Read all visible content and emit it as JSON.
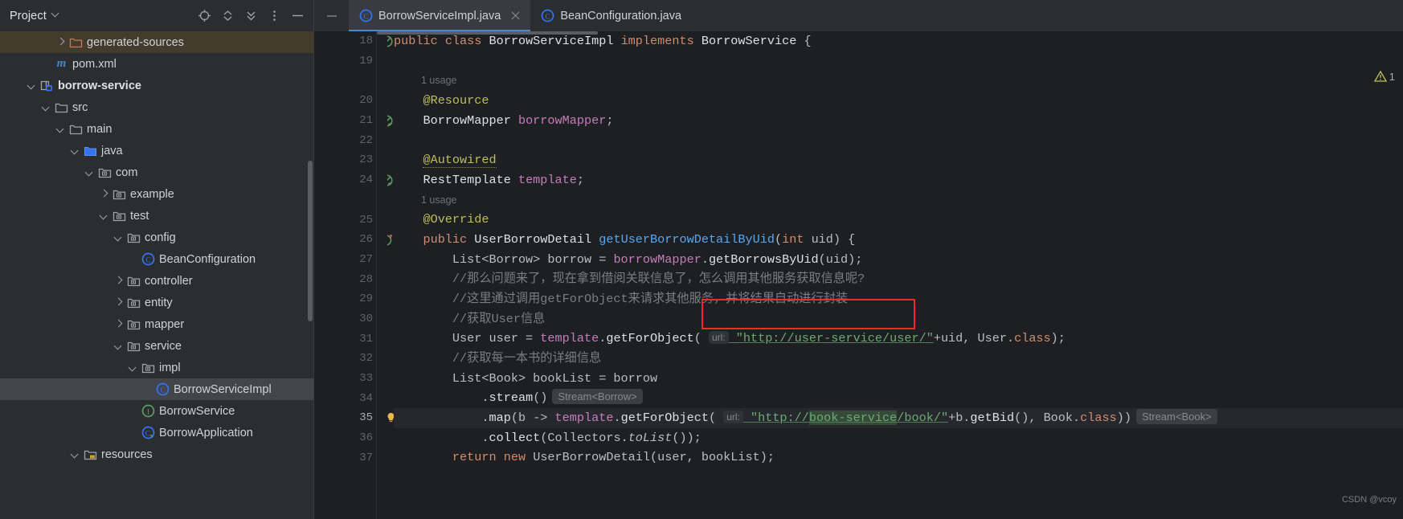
{
  "colors": {
    "panel_bg": "#2b2d30",
    "editor_bg": "#1e1f22",
    "accent_tab": "#4a88c7",
    "annotation_red": "#f42a28",
    "string_green": "#6aab73",
    "keyword_orange": "#cf8e6d",
    "field_purple": "#c77dbb",
    "method_blue": "#56a8f5",
    "comment_gray": "#7a7e85",
    "selected_row": "#43454a",
    "amber_row": "#433b2b"
  },
  "left_panel": {
    "title": "Project",
    "title_chevron_icon": "chevron-down-icon",
    "actions": [
      {
        "name": "locate-icon",
        "tooltip": "Select Opened File"
      },
      {
        "name": "expand-collapse-icon",
        "tooltip": "Expand All"
      },
      {
        "name": "collapse-all-icon",
        "tooltip": "Collapse All"
      },
      {
        "name": "more-options-icon",
        "tooltip": "Options"
      },
      {
        "name": "hide-panel-icon",
        "tooltip": "Hide"
      }
    ],
    "tree": [
      {
        "label": "generated-sources",
        "indent": 3,
        "twisty": "right",
        "icon": "folder-orange-icon",
        "highlight": "amber",
        "bold": false
      },
      {
        "label": "pom.xml",
        "indent": 2,
        "twisty": "none",
        "icon": "maven-m-icon",
        "highlight": "none",
        "bold": false
      },
      {
        "label": "borrow-service",
        "indent": 1,
        "twisty": "down",
        "icon": "module-icon",
        "highlight": "none",
        "bold": true
      },
      {
        "label": "src",
        "indent": 2,
        "twisty": "down",
        "icon": "folder-icon",
        "highlight": "none",
        "bold": false
      },
      {
        "label": "main",
        "indent": 3,
        "twisty": "down",
        "icon": "folder-icon",
        "highlight": "none",
        "bold": false
      },
      {
        "label": "java",
        "indent": 4,
        "twisty": "down",
        "icon": "source-root-icon",
        "highlight": "none",
        "bold": false
      },
      {
        "label": "com",
        "indent": 5,
        "twisty": "down",
        "icon": "package-icon",
        "highlight": "none",
        "bold": false
      },
      {
        "label": "example",
        "indent": 6,
        "twisty": "right",
        "icon": "package-icon",
        "highlight": "none",
        "bold": false
      },
      {
        "label": "test",
        "indent": 6,
        "twisty": "down",
        "icon": "package-icon",
        "highlight": "none",
        "bold": false
      },
      {
        "label": "config",
        "indent": 7,
        "twisty": "down",
        "icon": "package-icon",
        "highlight": "none",
        "bold": false
      },
      {
        "label": "BeanConfiguration",
        "indent": 8,
        "twisty": "none",
        "icon": "java-class-icon",
        "highlight": "none",
        "bold": false
      },
      {
        "label": "controller",
        "indent": 7,
        "twisty": "right",
        "icon": "package-icon",
        "highlight": "none",
        "bold": false
      },
      {
        "label": "entity",
        "indent": 7,
        "twisty": "right",
        "icon": "package-icon",
        "highlight": "none",
        "bold": false
      },
      {
        "label": "mapper",
        "indent": 7,
        "twisty": "right",
        "icon": "package-icon",
        "highlight": "none",
        "bold": false
      },
      {
        "label": "service",
        "indent": 7,
        "twisty": "down",
        "icon": "package-icon",
        "highlight": "none",
        "bold": false
      },
      {
        "label": "impl",
        "indent": 8,
        "twisty": "down",
        "icon": "package-icon",
        "highlight": "none",
        "bold": false
      },
      {
        "label": "BorrowServiceImpl",
        "indent": 9,
        "twisty": "none",
        "icon": "java-class-icon",
        "highlight": "selected",
        "bold": false
      },
      {
        "label": "BorrowService",
        "indent": 8,
        "twisty": "none",
        "icon": "java-interface-icon",
        "highlight": "none",
        "bold": false
      },
      {
        "label": "BorrowApplication",
        "indent": 8,
        "twisty": "none",
        "icon": "spring-class-icon",
        "highlight": "none",
        "bold": false
      },
      {
        "label": "resources",
        "indent": 4,
        "twisty": "down",
        "icon": "resource-root-icon",
        "highlight": "none",
        "bold": false
      }
    ]
  },
  "tabs": [
    {
      "label": "BorrowServiceImpl.java",
      "icon": "java-class-icon",
      "active": true,
      "closable": true
    },
    {
      "label": "BeanConfiguration.java",
      "icon": "java-class-icon",
      "active": false,
      "closable": false
    }
  ],
  "inspection_widget": {
    "icon": "warning-triangle-icon",
    "count": "1"
  },
  "watermark": "CSDN @vcoy",
  "editor": {
    "current_line": "35",
    "lines": [
      {
        "num": "18",
        "marker": "implementing-method-icon",
        "indent": 0,
        "tokens": [
          {
            "t": "public ",
            "c": "kw"
          },
          {
            "t": "class ",
            "c": "kw"
          },
          {
            "t": "BorrowServiceImpl ",
            "c": "cls"
          },
          {
            "t": "implements ",
            "c": "kw"
          },
          {
            "t": "BorrowService ",
            "c": "cls"
          },
          {
            "t": "{",
            "c": "pl"
          }
        ]
      },
      {
        "num": "19",
        "marker": "",
        "indent": 0,
        "tokens": []
      },
      {
        "num": "",
        "hint": "1 usage"
      },
      {
        "num": "20",
        "marker": "",
        "indent": 1,
        "tokens": [
          {
            "t": "@Resource",
            "c": "ann"
          }
        ]
      },
      {
        "num": "21",
        "marker": "implemented-interface-icon",
        "indent": 1,
        "tokens": [
          {
            "t": "BorrowMapper ",
            "c": "cls"
          },
          {
            "t": "borrowMapper",
            "c": "fld"
          },
          {
            "t": ";",
            "c": "pl"
          }
        ]
      },
      {
        "num": "22",
        "marker": "",
        "indent": 0,
        "tokens": []
      },
      {
        "num": "23",
        "marker": "",
        "indent": 1,
        "tokens": [
          {
            "t": "@Autowired",
            "c": "annu"
          }
        ]
      },
      {
        "num": "24",
        "marker": "implemented-interface-icon",
        "indent": 1,
        "tokens": [
          {
            "t": "RestTemplate ",
            "c": "cls"
          },
          {
            "t": "template",
            "c": "fld"
          },
          {
            "t": ";",
            "c": "pl"
          }
        ]
      },
      {
        "num": "",
        "hint": "1 usage"
      },
      {
        "num": "25",
        "marker": "",
        "indent": 1,
        "tokens": [
          {
            "t": "@Override",
            "c": "ann"
          }
        ]
      },
      {
        "num": "26",
        "marker": "overriding-method-icon",
        "indent": 1,
        "tokens": [
          {
            "t": "public ",
            "c": "kw"
          },
          {
            "t": "UserBorrowDetail ",
            "c": "cls"
          },
          {
            "t": "getUserBorrowDetailByUid",
            "c": "mth"
          },
          {
            "t": "(",
            "c": "pl"
          },
          {
            "t": "int",
            "c": "kw"
          },
          {
            "t": " uid) {",
            "c": "pl"
          }
        ]
      },
      {
        "num": "27",
        "marker": "",
        "indent": 2,
        "tokens": [
          {
            "t": "List<Borrow> borrow = ",
            "c": "pl"
          },
          {
            "t": "borrowMapper",
            "c": "fld"
          },
          {
            "t": ".",
            "c": "pl"
          },
          {
            "t": "getBorrowsByUid",
            "c": "mthy"
          },
          {
            "t": "(uid);",
            "c": "pl"
          }
        ]
      },
      {
        "num": "28",
        "marker": "",
        "indent": 2,
        "tokens": [
          {
            "t": "//那么问题来了，现在拿到借阅关联信息了，怎么调用其他服务获取信息呢?",
            "c": "cmt"
          }
        ]
      },
      {
        "num": "29",
        "marker": "",
        "indent": 2,
        "tokens": [
          {
            "t": "//这里通过调用getForObject来请求其他服务，并将结果自动进行封装",
            "c": "cmt"
          }
        ]
      },
      {
        "num": "30",
        "marker": "",
        "indent": 2,
        "tokens": [
          {
            "t": "//获取User信息",
            "c": "cmt"
          }
        ]
      },
      {
        "num": "31",
        "marker": "",
        "indent": 2,
        "tokens": [
          {
            "t": "User user = ",
            "c": "pl"
          },
          {
            "t": "template",
            "c": "fld"
          },
          {
            "t": ".",
            "c": "pl"
          },
          {
            "t": "getForObject",
            "c": "mthy"
          },
          {
            "t": "( ",
            "c": "pl"
          },
          {
            "t": "url:",
            "c": "inlay-param"
          },
          {
            "t": " \"http://user-service/user/\"",
            "c": "strl"
          },
          {
            "t": "+uid, User.",
            "c": "pl"
          },
          {
            "t": "class",
            "c": "kw"
          },
          {
            "t": ");",
            "c": "pl"
          }
        ]
      },
      {
        "num": "32",
        "marker": "",
        "indent": 2,
        "tokens": [
          {
            "t": "//获取每一本书的详细信息",
            "c": "cmt"
          }
        ]
      },
      {
        "num": "33",
        "marker": "",
        "indent": 2,
        "tokens": [
          {
            "t": "List<Book> bookList = borrow",
            "c": "pl"
          }
        ]
      },
      {
        "num": "34",
        "marker": "",
        "indent": 3,
        "tokens": [
          {
            "t": ".",
            "c": "pl"
          },
          {
            "t": "stream",
            "c": "mthy"
          },
          {
            "t": "()",
            "c": "pl"
          },
          {
            "t": "Stream<Borrow>",
            "c": "inlay-type"
          }
        ]
      },
      {
        "num": "35",
        "marker": "intention-bulb-icon",
        "indent": 3,
        "current": true,
        "tokens": [
          {
            "t": ".",
            "c": "pl"
          },
          {
            "t": "map",
            "c": "mthy"
          },
          {
            "t": "(b -> ",
            "c": "pl"
          },
          {
            "t": "template",
            "c": "fld"
          },
          {
            "t": ".",
            "c": "pl"
          },
          {
            "t": "getForObject",
            "c": "mthy"
          },
          {
            "t": "( ",
            "c": "pl"
          },
          {
            "t": "url:",
            "c": "inlay-param"
          },
          {
            "t": " \"http://",
            "c": "strl"
          },
          {
            "t": "book-service",
            "c": "sel-hl-str"
          },
          {
            "t": "/book/\"",
            "c": "strl"
          },
          {
            "t": "+b.",
            "c": "pl"
          },
          {
            "t": "getBid",
            "c": "mthy"
          },
          {
            "t": "(), Book.",
            "c": "pl"
          },
          {
            "t": "class",
            "c": "kw"
          },
          {
            "t": "))",
            "c": "pl"
          },
          {
            "t": "Stream<Book>",
            "c": "inlay-type"
          }
        ]
      },
      {
        "num": "36",
        "marker": "",
        "indent": 3,
        "tokens": [
          {
            "t": ".",
            "c": "pl"
          },
          {
            "t": "collect",
            "c": "mthy"
          },
          {
            "t": "(Collectors.",
            "c": "pl"
          },
          {
            "t": "toList",
            "c": "stat"
          },
          {
            "t": "());",
            "c": "pl"
          }
        ]
      },
      {
        "num": "37",
        "marker": "",
        "indent": 2,
        "tokens": [
          {
            "t": "return ",
            "c": "kw"
          },
          {
            "t": "new ",
            "c": "kw"
          },
          {
            "t": "UserBorrowDetail(user, bookList);",
            "c": "pl"
          }
        ]
      }
    ]
  }
}
